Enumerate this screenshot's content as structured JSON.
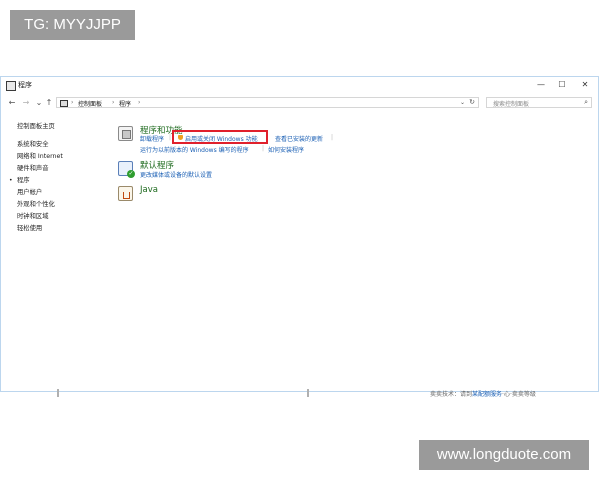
{
  "watermarks": {
    "top": "TG: MYYJJPP",
    "bottom": "www.longduote.com"
  },
  "window": {
    "title": "程序",
    "controls": {
      "minimize": "—",
      "maximize": "☐",
      "close": "✕"
    }
  },
  "toolbar": {
    "back": "←",
    "forward": "→",
    "dropdown": "⌄",
    "up": "↑",
    "breadcrumb": [
      "控制面板",
      "程序"
    ],
    "separator": "›",
    "refresh": "↻",
    "search_placeholder": "搜索控制面板",
    "search_icon": "⌕"
  },
  "sidebar": {
    "home": "控制面板主页",
    "items": [
      "系统和安全",
      "网络和 Internet",
      "硬件和声音",
      "程序",
      "用户帐户",
      "外观和个性化",
      "时钟和区域",
      "轻松使用"
    ],
    "active_index": 3,
    "bullet": "•"
  },
  "sections": {
    "programs_features": {
      "title": "程序和功能",
      "links": [
        "卸载程序",
        "启用或关闭 Windows 功能",
        "查看已安装的更新",
        "运行为以前版本的 Windows 编写的程序",
        "如何安装程序"
      ]
    },
    "default_programs": {
      "title": "默认程序",
      "links": [
        "更改媒体或设备的默认设置"
      ]
    },
    "java": {
      "title": "Java"
    }
  },
  "status": {
    "prefix": "卖卖技术：",
    "body": "请到",
    "link": "某配额服务",
    "tail": "·心·卖卖等级"
  },
  "colors": {
    "highlight": "#e0202c",
    "link": "#1a5fb4",
    "section_title": "#1e6a1e"
  },
  "icons": {
    "section1": "programs-icon",
    "section2": "default-programs-icon",
    "section3": "java-icon",
    "shield": "uac-shield-icon",
    "check": "check-icon"
  }
}
